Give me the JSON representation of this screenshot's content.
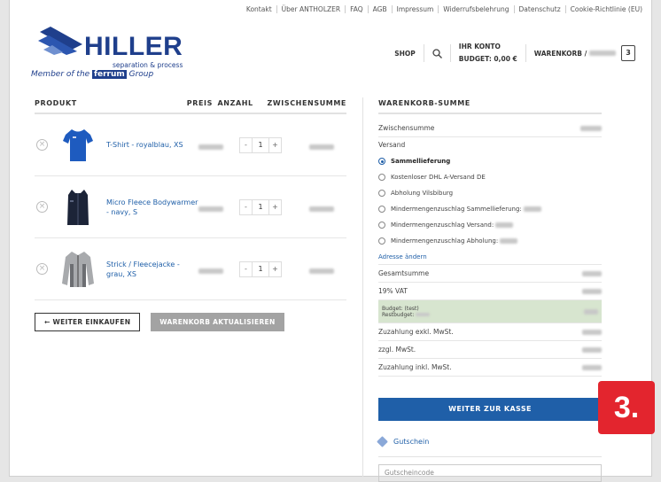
{
  "topnav": [
    "Kontakt",
    "Über ANTHOLZER",
    "FAQ",
    "AGB",
    "Impressum",
    "Widerrufsbelehrung",
    "Datenschutz",
    "Cookie-Richtlinie (EU)"
  ],
  "logo": {
    "brand": "HILLER",
    "sub": "separation & process",
    "member_prefix": "Member of the ",
    "member_brand": "ferrum",
    "member_suffix": " Group"
  },
  "header": {
    "shop": "SHOP",
    "account_title": "IHR KONTO",
    "budget": "BUDGET: 0,00 €",
    "cart_label": "WARENKORB /",
    "cart_count": "3"
  },
  "cart": {
    "columns": {
      "product": "PRODUKT",
      "price": "PREIS",
      "qty": "ANZAHL",
      "subtotal": "ZWISCHENSUMME"
    },
    "items": [
      {
        "name": "T-Shirt - royalblau, XS",
        "qty": "1",
        "image": "tshirt-image"
      },
      {
        "name": "Micro Fleece Bodywarmer - navy, S",
        "qty": "1",
        "image": "bodywarmer-image"
      },
      {
        "name": "Strick / Fleecejacke - grau, XS",
        "qty": "1",
        "image": "fleecejacket-image"
      }
    ],
    "continue_label": "← WEITER EINKAUFEN",
    "update_label": "WARENKORB AKTUALISIEREN"
  },
  "totals": {
    "heading": "WARENKORB-SUMME",
    "subtotal_label": "Zwischensumme",
    "shipping_label": "Versand",
    "shipping_options": [
      {
        "label": "Sammellieferung",
        "selected": true
      },
      {
        "label": "Kostenloser DHL A-Versand DE",
        "selected": false
      },
      {
        "label": "Abholung Vilsbiburg",
        "selected": false
      },
      {
        "label": "Mindermengenzuschlag Sammellieferung:",
        "selected": false
      },
      {
        "label": "Mindermengenzuschlag Versand:",
        "selected": false
      },
      {
        "label": "Mindermengenzuschlag Abholung:",
        "selected": false
      }
    ],
    "change_address": "Adresse ändern",
    "total_label": "Gesamtsumme",
    "vat_label": "19% VAT",
    "budget_label": "Budget: (test)",
    "rest_budget_label": "Restbudget:",
    "extra_net_label": "Zuzahlung exkl. MwSt.",
    "plus_vat_label": "zzgl. MwSt.",
    "extra_gross_label": "Zuzahlung inkl. MwSt.",
    "checkout_label": "WEITER ZUR KASSE",
    "voucher_label": "Gutschein",
    "voucher_placeholder": "Gutscheincode"
  },
  "step_badge": "3.",
  "colors": {
    "brand_blue": "#1f3f8c",
    "link_blue": "#1f5fa8",
    "badge_red": "#e3252e",
    "budget_green": "#d7e5cf"
  }
}
